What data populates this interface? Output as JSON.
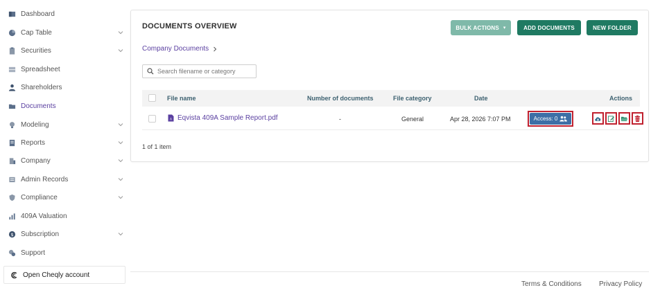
{
  "sidebar": {
    "items": [
      {
        "label": "Dashboard",
        "icon": "dashboard-icon",
        "expandable": false
      },
      {
        "label": "Cap Table",
        "icon": "pie-chart-icon",
        "expandable": true
      },
      {
        "label": "Securities",
        "icon": "clipboard-icon",
        "expandable": true
      },
      {
        "label": "Spreadsheet",
        "icon": "spreadsheet-icon",
        "expandable": false
      },
      {
        "label": "Shareholders",
        "icon": "user-icon",
        "expandable": false
      },
      {
        "label": "Documents",
        "icon": "folder-icon",
        "expandable": false,
        "active": true
      },
      {
        "label": "Modeling",
        "icon": "lightbulb-icon",
        "expandable": true
      },
      {
        "label": "Reports",
        "icon": "report-icon",
        "expandable": true
      },
      {
        "label": "Company",
        "icon": "building-icon",
        "expandable": true
      },
      {
        "label": "Admin Records",
        "icon": "records-icon",
        "expandable": true
      },
      {
        "label": "Compliance",
        "icon": "shield-icon",
        "expandable": true
      },
      {
        "label": "409A Valuation",
        "icon": "chart-icon",
        "expandable": false
      },
      {
        "label": "Subscription",
        "icon": "dollar-icon",
        "expandable": true
      },
      {
        "label": "Support",
        "icon": "support-icon",
        "expandable": false
      }
    ],
    "cheqly_label": "Open Cheqly account"
  },
  "header": {
    "title": "DOCUMENTS OVERVIEW",
    "bulk_actions_label": "BULK ACTIONS",
    "add_documents_label": "ADD DOCUMENTS",
    "new_folder_label": "NEW FOLDER"
  },
  "breadcrumb": {
    "label": "Company Documents"
  },
  "search": {
    "placeholder": "Search filename or category",
    "value": ""
  },
  "table": {
    "columns": {
      "file_name": "File name",
      "num_documents": "Number of documents",
      "file_category": "File category",
      "date": "Date",
      "actions": "Actions"
    },
    "rows": [
      {
        "file_name": "Eqvista 409A Sample Report.pdf",
        "num_documents": "-",
        "file_category": "General",
        "date": "Apr 28, 2026 7:07 PM",
        "access_label": "Access: 0"
      }
    ],
    "pager": "1 of 1 item"
  },
  "footer": {
    "terms": "Terms & Conditions",
    "privacy": "Privacy Policy"
  },
  "colors": {
    "accent_purple": "#5a3fa0",
    "button_green": "#1f7a62",
    "button_green_light": "#7fb9a9",
    "access_blue": "#3d6fa6",
    "highlight_red": "#c0212f",
    "header_teal": "#3d6170"
  }
}
